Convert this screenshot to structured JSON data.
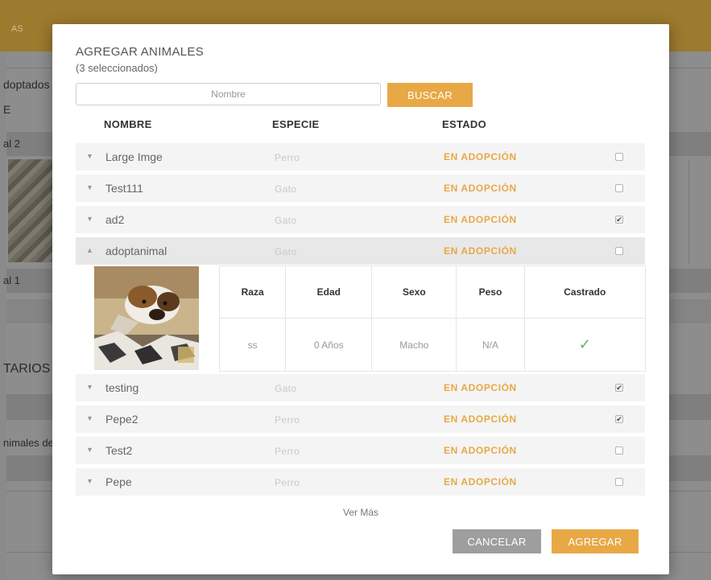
{
  "background": {
    "crumb": "AS",
    "adoptados": "doptados",
    "e_label": "E",
    "animal2": "al 2",
    "animal1": "al 1",
    "comentarios": "TARIOS",
    "animales": "nimales de"
  },
  "modal": {
    "title": "AGREGAR ANIMALES",
    "subtitle": "(3 seleccionados)",
    "search_placeholder": "Nombre",
    "search_value": "",
    "search_button": "BUSCAR",
    "columns": {
      "name": "NOMBRE",
      "species": "ESPECIE",
      "status": "ESTADO"
    },
    "rows": [
      {
        "name": "Large Imge",
        "species": "Perro",
        "status": "EN ADOPCIÓN",
        "checked": false,
        "chevron": "▼"
      },
      {
        "name": "Test111",
        "species": "Gato",
        "status": "EN ADOPCIÓN",
        "checked": false,
        "chevron": "▼"
      },
      {
        "name": "ad2",
        "species": "Gato",
        "status": "EN ADOPCIÓN",
        "checked": true,
        "chevron": "▼"
      },
      {
        "name": "adoptanimal",
        "species": "Gato",
        "status": "EN ADOPCIÓN",
        "checked": false,
        "chevron": "▲"
      },
      {
        "name": "testing",
        "species": "Gato",
        "status": "EN ADOPCIÓN",
        "checked": true,
        "chevron": "▼"
      },
      {
        "name": "Pepe2",
        "species": "Perro",
        "status": "EN ADOPCIÓN",
        "checked": true,
        "chevron": "▼"
      },
      {
        "name": "Test2",
        "species": "Perro",
        "status": "EN ADOPCIÓN",
        "checked": false,
        "chevron": "▼"
      },
      {
        "name": "Pepe",
        "species": "Perro",
        "status": "EN ADOPCIÓN",
        "checked": false,
        "chevron": "▼"
      }
    ],
    "detail": {
      "headers": [
        "Raza",
        "Edad",
        "Sexo",
        "Peso",
        "Castrado"
      ],
      "values": [
        "ss",
        "0 Años",
        "Macho",
        "N/A",
        "✓"
      ]
    },
    "ver_mas": "Ver Más",
    "cancel_button": "CANCELAR",
    "add_button": "AGREGAR",
    "colors": {
      "accent": "#e8a846",
      "cancel": "#9e9e9e",
      "check": "#5cb85c"
    }
  }
}
